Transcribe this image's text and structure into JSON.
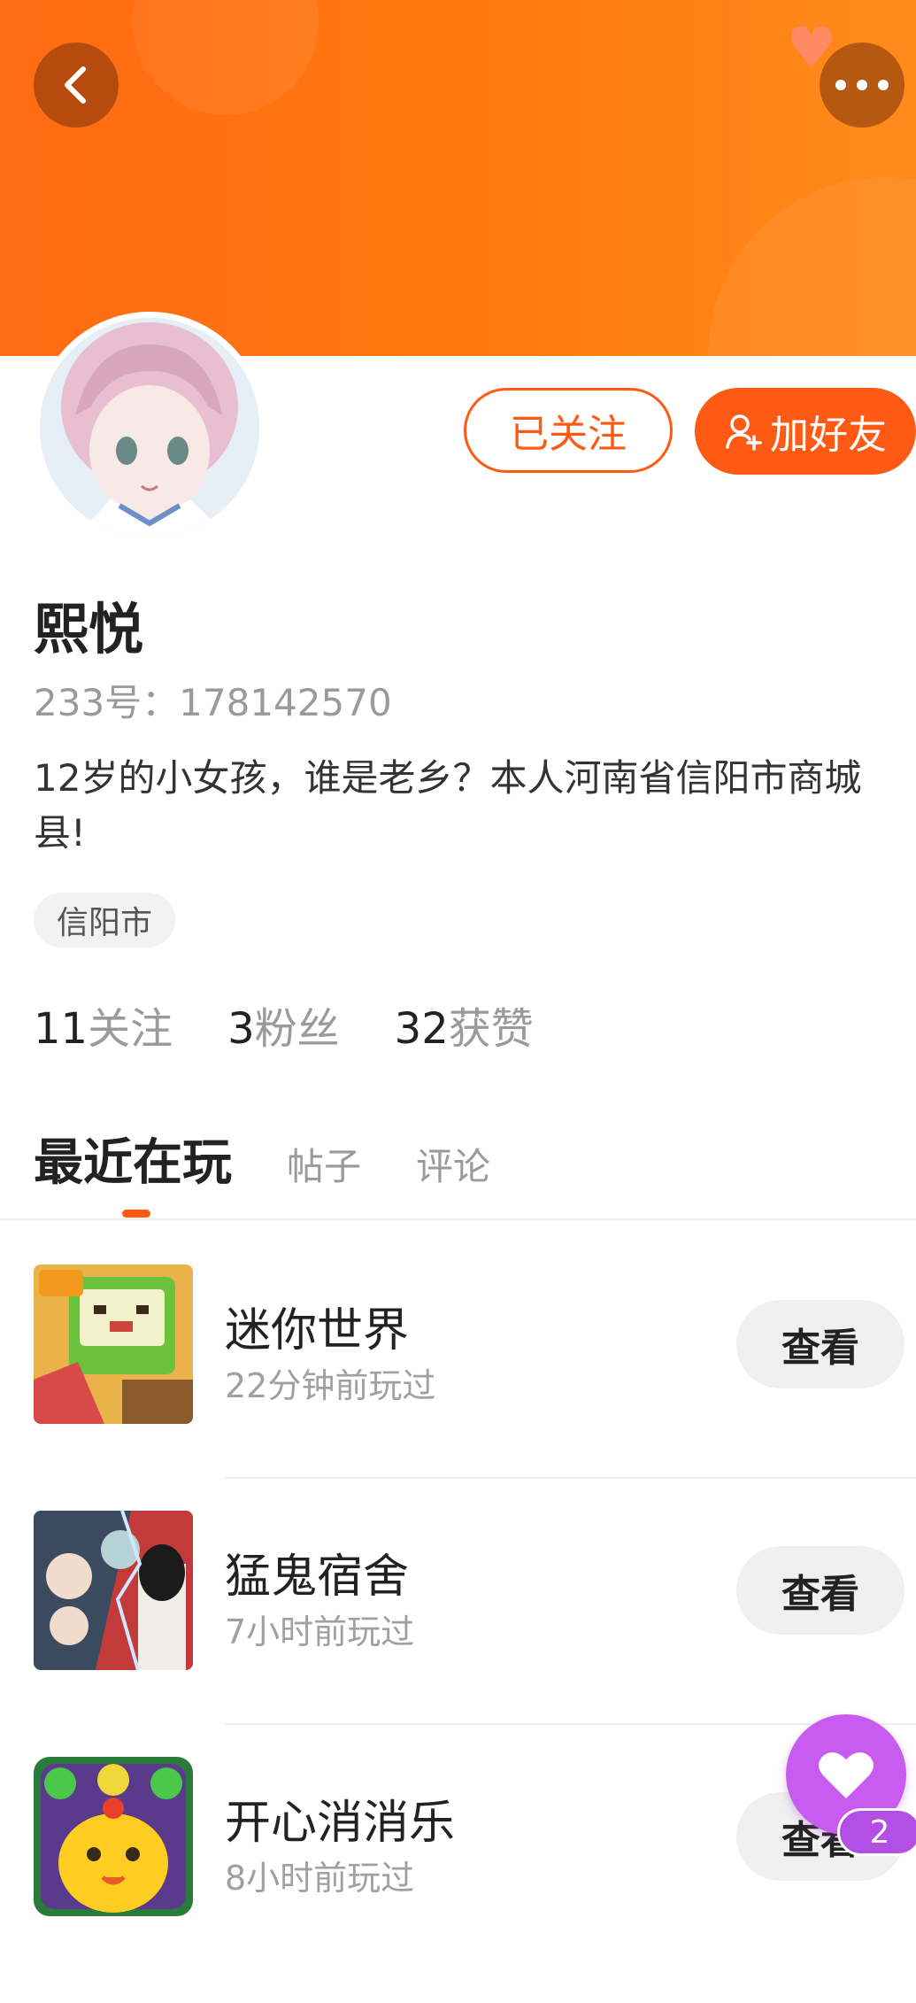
{
  "header": {
    "back_icon": "chevron-left-icon",
    "more_icon": "more-dots-icon"
  },
  "profile": {
    "name": "熙悦",
    "uid": "233号：178142570",
    "bio": "12岁的小女孩，谁是老乡？本人河南省信阳市商城县!",
    "tag": "信阳市",
    "followed_label": "已关注",
    "add_friend_label": "加好友"
  },
  "stats": {
    "following_count": "11",
    "following_label": "关注",
    "fans_count": "3",
    "fans_label": "粉丝",
    "likes_count": "32",
    "likes_label": "获赞"
  },
  "tabs": [
    {
      "label": "最近在玩",
      "active": true
    },
    {
      "label": "帖子",
      "active": false
    },
    {
      "label": "评论",
      "active": false
    }
  ],
  "games": [
    {
      "title": "迷你世界",
      "time": "22分钟前玩过",
      "button": "查看"
    },
    {
      "title": "猛鬼宿舍",
      "time": "7小时前玩过",
      "button": "查看"
    },
    {
      "title": "开心消消乐",
      "time": "8小时前玩过",
      "button": "查看"
    }
  ],
  "fab": {
    "like_count": "2"
  },
  "colors": {
    "accent": "#ff5a14",
    "banner": "#ff7a10",
    "fab": "#c85cf0"
  }
}
